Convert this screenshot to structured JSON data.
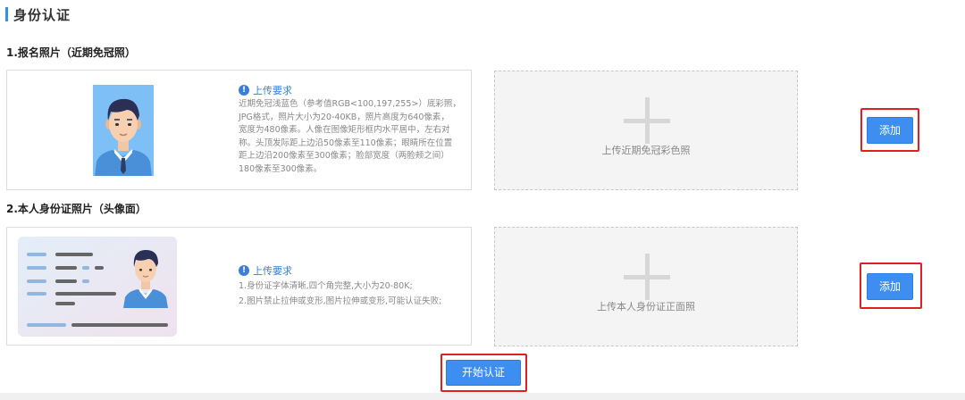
{
  "header": {
    "title": "身份认证"
  },
  "sections": [
    {
      "title": "1.报名照片（近期免冠照）",
      "requirements_title": "上传要求",
      "requirements_lines": [
        "近期免冠浅蓝色（参考值RGB<100,197,255>）底彩照，",
        "JPG格式，照片大小为20-40KB，照片高度为640像素，",
        "宽度为480像素。人像在图像矩形框内水平居中，左右对",
        "称。头顶发际距上边沿50像素至110像素；眼睛所在位置",
        "距上边沿200像素至300像素；脸部宽度（两脸颊之间）",
        "180像素至300像素。"
      ],
      "upload_label": "上传近期免冠彩色照",
      "add_label": "添加"
    },
    {
      "title": "2.本人身份证照片（头像面）",
      "requirements_title": "上传要求",
      "requirements_lines": [
        "1.身份证字体清晰,四个角完整,大小为20-80K;",
        "2.图片禁止拉伸或变形,图片拉伸或变形,可能认证失败;"
      ],
      "upload_label": "上传本人身份证正面照",
      "add_label": "添加"
    }
  ],
  "start_button": {
    "label": "开始认证"
  },
  "colors": {
    "accent": "#3d8ef0",
    "highlight": "#e02020",
    "photo_bg": "#7ec0f5"
  },
  "icons": {
    "info": "info-icon",
    "plus": "plus-icon"
  }
}
